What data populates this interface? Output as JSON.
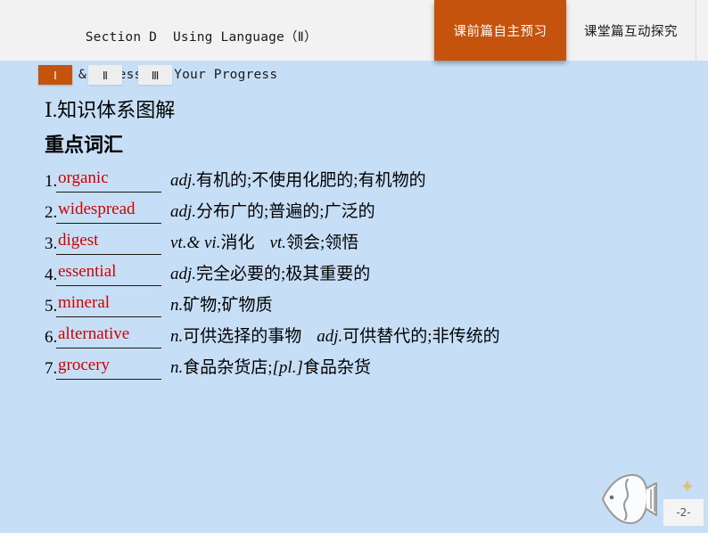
{
  "header": {
    "title_line1": "Section D  Using Language（Ⅱ）",
    "title_line2": "& Assessing Your Progress",
    "tabs": [
      {
        "label": "课前篇自主预习",
        "active": true
      },
      {
        "label": "课堂篇互动探究",
        "active": false
      }
    ]
  },
  "numeral_tabs": [
    {
      "label": "Ⅰ",
      "active": true
    },
    {
      "label": "Ⅱ",
      "active": false
    },
    {
      "label": "Ⅲ",
      "active": false
    }
  ],
  "main": {
    "section_heading": "Ⅰ.知识体系图解",
    "sub_heading": "重点词汇",
    "vocabulary": [
      {
        "num": "1.",
        "word": "organic",
        "pos": "adj.",
        "meaning": "有机的;不使用化肥的;有机物的",
        "pos2": "",
        "meaning2": ""
      },
      {
        "num": "2.",
        "word": "widespread",
        "pos": "adj.",
        "meaning": "分布广的;普遍的;广泛的",
        "pos2": "",
        "meaning2": ""
      },
      {
        "num": "3.",
        "word": "digest",
        "pos": "vt.& vi.",
        "meaning": "消化",
        "pos2": "vt.",
        "meaning2": "领会;领悟"
      },
      {
        "num": "4.",
        "word": "essential",
        "pos": "adj.",
        "meaning": "完全必要的;极其重要的",
        "pos2": "",
        "meaning2": ""
      },
      {
        "num": "5.",
        "word": "mineral",
        "pos": "n.",
        "meaning": "矿物;矿物质",
        "pos2": "",
        "meaning2": ""
      },
      {
        "num": "6.",
        "word": "alternative",
        "pos": "n.",
        "meaning": "可供选择的事物",
        "pos2": "adj.",
        "meaning2": "可供替代的;非传统的"
      },
      {
        "num": "7.",
        "word": "grocery",
        "pos": "n.",
        "meaning": "食品杂货店;",
        "pos2": "[pl.]",
        "meaning2": "食品杂货"
      }
    ]
  },
  "footer": {
    "page_number": "-2-"
  },
  "colors": {
    "accent": "#c5520d",
    "page_background": "#c6dff7",
    "header_background": "#f2f2f2",
    "word_red": "#d00000"
  }
}
